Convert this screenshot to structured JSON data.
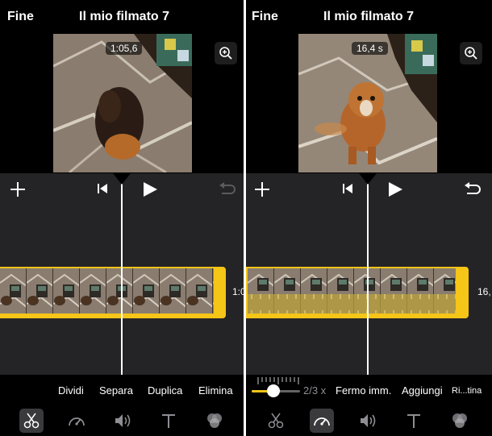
{
  "left": {
    "done_label": "Fine",
    "title": "Il mio filmato 7",
    "timecode": "1:05,6",
    "side_time": "1:0",
    "actions": [
      "Dividi",
      "Separa",
      "Duplica",
      "Elimina"
    ],
    "tools": [
      "scissors-icon",
      "speedometer-icon",
      "speaker-icon",
      "text-icon",
      "filters-icon"
    ],
    "selected_tool": "scissors-icon"
  },
  "right": {
    "done_label": "Fine",
    "title": "Il mio filmato 7",
    "timecode": "16,4 s",
    "side_time": "16,",
    "speed_label": "2/3 x",
    "speed_fraction": 0.45,
    "actions": [
      "Fermo imm.",
      "Aggiungi",
      "Ri...tina"
    ],
    "tools": [
      "scissors-icon",
      "speedometer-icon",
      "speaker-icon",
      "text-icon",
      "filters-icon"
    ],
    "selected_tool": "speedometer-icon"
  },
  "colors": {
    "accent": "#f5c518",
    "timeline_bg": "#242426",
    "icon_gray": "#8e8e93"
  }
}
